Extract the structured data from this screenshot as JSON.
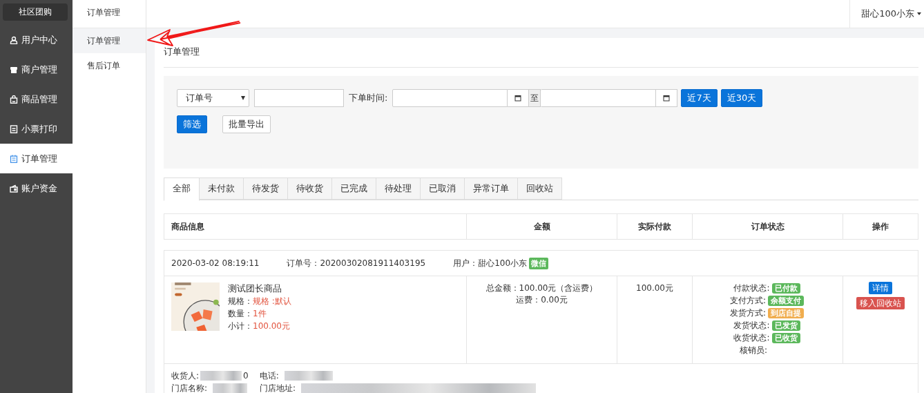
{
  "sidebar": {
    "brand": "社区团购",
    "items": [
      {
        "label": "用户中心",
        "selected": false
      },
      {
        "label": "商户管理",
        "selected": false
      },
      {
        "label": "商品管理",
        "selected": false
      },
      {
        "label": "小票打印",
        "selected": false
      },
      {
        "label": "订单管理",
        "selected": true
      },
      {
        "label": "账户资金",
        "selected": false
      }
    ]
  },
  "subnav": {
    "title": "订单管理",
    "items": [
      {
        "label": "订单管理",
        "selected": true
      },
      {
        "label": "售后订单",
        "selected": false
      }
    ]
  },
  "topbar": {
    "user": "甜心100小东"
  },
  "page_title": "订单管理",
  "filter": {
    "search_type": "订单号",
    "time_label": "下单时间:",
    "range_sep": "至",
    "quick": [
      "近7天",
      "近30天"
    ],
    "filter_button": "筛选",
    "export_button": "批量导出"
  },
  "tabs": [
    {
      "label": "全部",
      "selected": true
    },
    {
      "label": "未付款",
      "selected": false
    },
    {
      "label": "待发货",
      "selected": false
    },
    {
      "label": "待收货",
      "selected": false
    },
    {
      "label": "已完成",
      "selected": false
    },
    {
      "label": "待处理",
      "selected": false
    },
    {
      "label": "已取消",
      "selected": false
    },
    {
      "label": "异常订单",
      "selected": false
    },
    {
      "label": "回收站",
      "selected": false
    }
  ],
  "table": {
    "columns": [
      "商品信息",
      "金额",
      "实际付款",
      "订单状态",
      "操作"
    ],
    "orders": [
      {
        "time": "2020-03-02 08:19:11",
        "order_no": "订单号：20200302081911403195",
        "user": "用户：甜心100小东",
        "user_tag": "微信",
        "product": {
          "name": "测试团长商品",
          "fields": [
            {
              "label": "规格：",
              "value": "规格 :默认"
            },
            {
              "label": "数量：",
              "value": "1件"
            },
            {
              "label": "小计：",
              "value": "100.00元"
            }
          ]
        },
        "amount": [
          "总金额：100.00元（含运费）",
          "运费：0.00元"
        ],
        "paid": "100.00元",
        "statuses": [
          {
            "label": "付款状态:",
            "value": "已付款",
            "color": "#5cb85c"
          },
          {
            "label": "支付方式:",
            "value": "余额支付",
            "color": "#5cb85c"
          },
          {
            "label": "发货方式:",
            "value": "到店自提",
            "color": "#f0ad4e"
          },
          {
            "label": "发货状态:",
            "value": "已发货",
            "color": "#5cb85c"
          },
          {
            "label": "收货状态:",
            "value": "已收货",
            "color": "#5cb85c"
          }
        ],
        "verifier_label": "核销员:",
        "detail_button": "详情",
        "trash_button": "移入回收站",
        "receiver_label": "收货人:",
        "receiver_tail": "0",
        "phone_label": "电话:",
        "store_name_label": "门店名称:",
        "store_address_label": "门店地址:"
      }
    ]
  }
}
